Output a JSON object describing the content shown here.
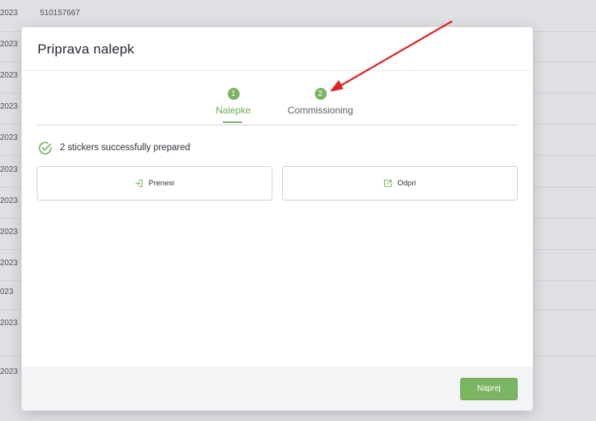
{
  "background": {
    "rows": [
      {
        "c1": "2023",
        "c2": "510157667"
      },
      {
        "c1": "2023",
        "c2": ""
      },
      {
        "c1": "2023",
        "c2": ""
      },
      {
        "c1": "2023",
        "c2": ""
      },
      {
        "c1": "2023",
        "c2": ""
      },
      {
        "c1": "2023",
        "c2": ""
      },
      {
        "c1": "2023",
        "c2": ""
      },
      {
        "c1": "2023",
        "c2": ""
      },
      {
        "c1": "2023",
        "c2": ""
      },
      {
        "c1": "023",
        "c2": ""
      },
      {
        "c1": "2023",
        "c2": ""
      },
      {
        "c1": "2023",
        "c2": ""
      }
    ]
  },
  "modal": {
    "title": "Priprava nalepk",
    "steps": [
      {
        "number": "1",
        "label": "Nalepke",
        "active": true
      },
      {
        "number": "2",
        "label": "Commissioning",
        "active": false
      }
    ],
    "status_text": "2 stickers successfully prepared",
    "buttons": {
      "prenesi": "Prenesi",
      "odpri": "Odpri"
    },
    "footer": {
      "next_label": "Naprej"
    }
  },
  "colors": {
    "accent": "#7cb561",
    "annotation_arrow": "#e02020"
  }
}
